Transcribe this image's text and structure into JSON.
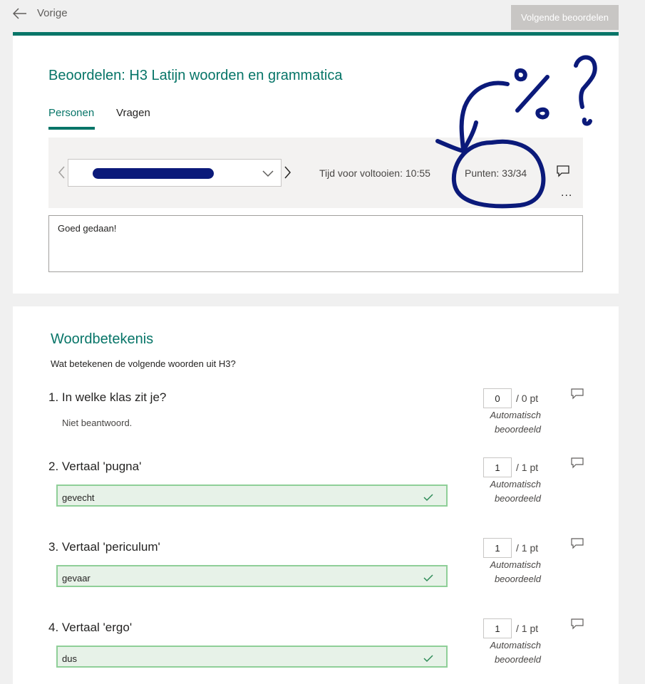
{
  "topbar": {
    "back_label": "Vorige",
    "next_label": "Volgende beoordelen"
  },
  "header": {
    "title": "Beoordelen: H3 Latijn woorden en grammatica",
    "tabs": [
      {
        "label": "Personen",
        "active": true
      },
      {
        "label": "Vragen",
        "active": false
      }
    ]
  },
  "toolbar": {
    "time_label": "Tijd voor voltooien: 10:55",
    "score_label": "Punten: 33/34",
    "more_label": "..."
  },
  "feedback": {
    "value": "Goed gedaan!"
  },
  "section": {
    "title": "Woordbetekenis",
    "description": "Wat betekenen de volgende woorden uit H3?"
  },
  "questions": [
    {
      "title": "1. In welke klas zit je?",
      "answer": "Niet beantwoord.",
      "answered": false,
      "score": "0",
      "max": "/ 0 pt",
      "auto_line1": "Automatisch",
      "auto_line2": "beoordeeld"
    },
    {
      "title": "2. Vertaal 'pugna'",
      "answer": "gevecht",
      "answered": true,
      "score": "1",
      "max": "/ 1 pt",
      "auto_line1": "Automatisch",
      "auto_line2": "beoordeeld"
    },
    {
      "title": "3. Vertaal 'periculum'",
      "answer": "gevaar",
      "answered": true,
      "score": "1",
      "max": "/ 1 pt",
      "auto_line1": "Automatisch",
      "auto_line2": "beoordeeld"
    },
    {
      "title": "4. Vertaal 'ergo'",
      "answer": "dus",
      "answered": true,
      "score": "1",
      "max": "/ 1 pt",
      "auto_line1": "Automatisch",
      "auto_line2": "beoordeeld"
    }
  ],
  "colors": {
    "accent": "#077568",
    "annotation_ink": "#0b1a7a",
    "correct_bg": "#e7f2e8",
    "correct_border": "#8fcf98",
    "check": "#2e8b57"
  },
  "icons": {
    "back": "arrow-left-icon",
    "chevron_left": "chevron-left-icon",
    "chevron_right": "chevron-right-icon",
    "chevron_down": "chevron-down-icon",
    "comment": "comment-icon",
    "check": "checkmark-icon"
  }
}
